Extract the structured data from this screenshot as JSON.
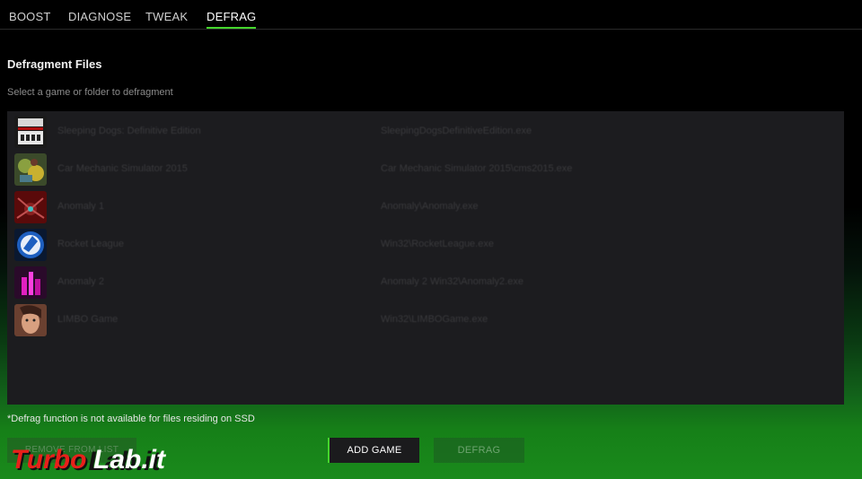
{
  "tabs": [
    {
      "label": "BOOST"
    },
    {
      "label": "DIAGNOSE"
    },
    {
      "label": "TWEAK"
    },
    {
      "label": "DEFRAG",
      "active": true
    }
  ],
  "section": {
    "title": "Defragment Files",
    "subtitle": "Select a game or folder to defragment"
  },
  "games": [
    {
      "name": "Sleeping Dogs: Definitive Edition",
      "path": "SleepingDogsDefinitiveEdition.exe",
      "icon": "sleeping-dogs-icon"
    },
    {
      "name": "Car Mechanic Simulator 2015",
      "path": "Car Mechanic Simulator 2015\\cms2015.exe",
      "icon": "car-mechanic-icon"
    },
    {
      "name": "Anomaly 1",
      "path": "Anomaly\\Anomaly.exe",
      "icon": "spider-icon"
    },
    {
      "name": "Rocket League",
      "path": "Win32\\RocketLeague.exe",
      "icon": "rocket-league-icon"
    },
    {
      "name": "Anomaly 2",
      "path": "Anomaly 2 Win32\\Anomaly2.exe",
      "icon": "pink-tower-icon"
    },
    {
      "name": "LIMBO Game",
      "path": "Win32\\LIMBOGame.exe",
      "icon": "portrait-icon"
    }
  ],
  "footer": {
    "note": "*Defrag function is not available for files residing on SSD",
    "remove_label": "REMOVE FROM LIST",
    "add_label": "ADD GAME",
    "defrag_label": "DEFRAG"
  },
  "watermark": "TurboLab.it",
  "colors": {
    "accent": "#44d62c",
    "panel": "#1c1c1f",
    "background": "#000000"
  }
}
